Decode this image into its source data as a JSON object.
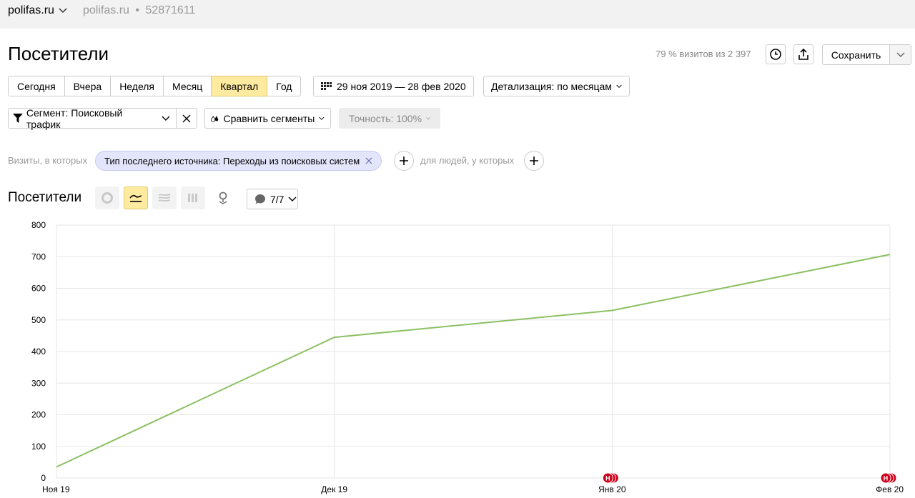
{
  "topbar": {
    "site": "polifas.ru",
    "site_secondary": "polifas.ru",
    "separator": "•",
    "counter_id": "52871611"
  },
  "page": {
    "title": "Посетители",
    "visits_note": "79 % визитов из 2 397",
    "save_label": "Сохранить"
  },
  "periods": [
    "Сегодня",
    "Вчера",
    "Неделя",
    "Месяц",
    "Квартал",
    "Год"
  ],
  "active_period": "Квартал",
  "date_range": "29 ноя 2019 — 28 фев 2020",
  "detail": "Детализация: по месяцам",
  "segment": {
    "label": "Сегмент: Поисковый трафик",
    "compare": "Сравнить сегменты",
    "accuracy": "Точность: 100%"
  },
  "conditions": {
    "visits_prefix": "Визиты, в которых",
    "chip": "Тип последнего источника: Переходы из поисковых систем",
    "people_prefix": "для людей, у которых"
  },
  "chart_section": {
    "title": "Посетители",
    "goals_count": "7/7"
  },
  "colors": {
    "accent_yellow": "#ffeba0",
    "chip_bg": "#e3e5fb",
    "line": "#8bc063",
    "annotation": "#d0021b"
  },
  "icons": [
    "chevron-down-icon",
    "clock-icon",
    "share-icon",
    "filter-icon",
    "close-icon",
    "drops-icon",
    "plus-icon",
    "pie-chart-icon",
    "line-chart-icon",
    "area-chart-icon",
    "bar-chart-icon",
    "map-icon",
    "comment-icon"
  ],
  "chart_data": {
    "type": "line",
    "categories": [
      "Ноя 19",
      "Дек 19",
      "Янв 20",
      "Фев 20"
    ],
    "series": [
      {
        "values": [
          35,
          445,
          530,
          707
        ]
      }
    ],
    "yticks": [
      0,
      100,
      200,
      300,
      400,
      500,
      600,
      700,
      800
    ],
    "ylim": [
      0,
      800
    ],
    "grid": true,
    "annotations": [
      {
        "category": "Янв 20",
        "label": "Н"
      },
      {
        "category": "Фев 20",
        "label": "Н"
      }
    ]
  }
}
